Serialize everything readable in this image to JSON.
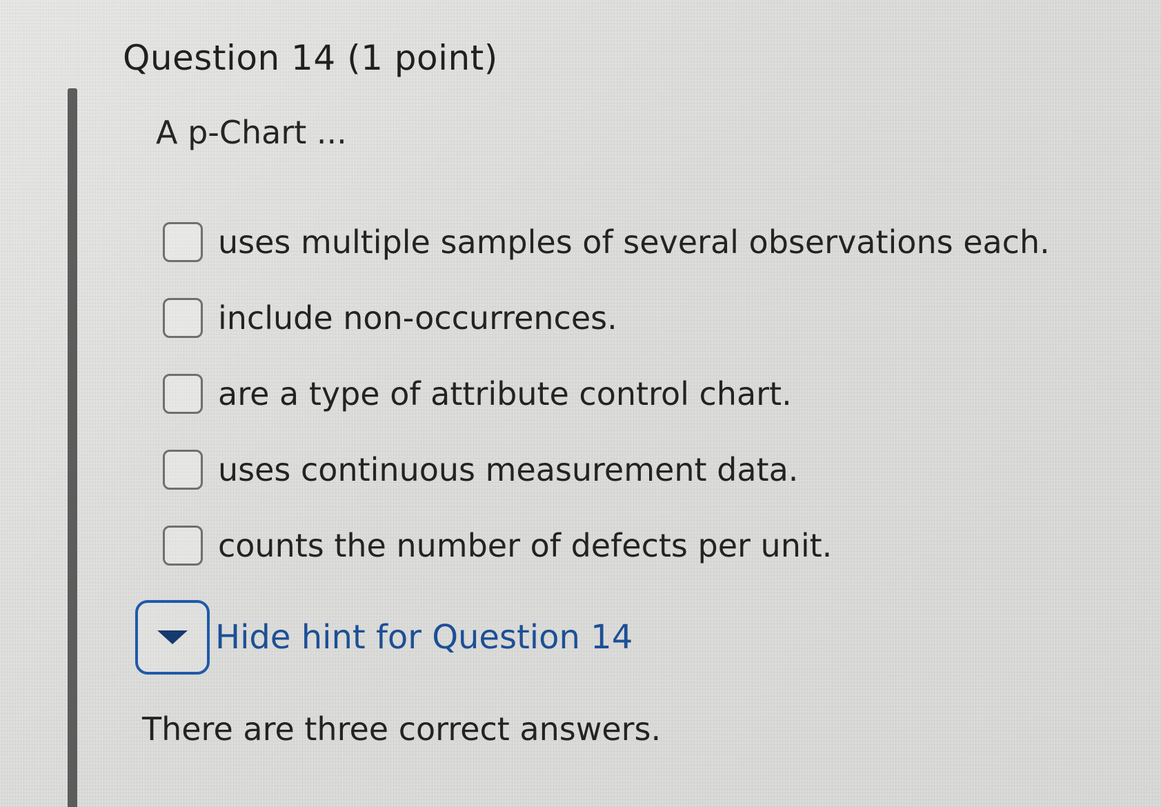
{
  "question": {
    "title": "Question 14",
    "points": "(1 point)",
    "prompt": "A p-Chart ...",
    "options": [
      {
        "label": "uses multiple samples of several observations each.",
        "checked": false
      },
      {
        "label": "include non-occurrences.",
        "checked": false
      },
      {
        "label": "are a type of attribute control chart.",
        "checked": false
      },
      {
        "label": "uses continuous measurement data.",
        "checked": false
      },
      {
        "label": "counts the number of defects per unit.",
        "checked": false
      }
    ]
  },
  "hint": {
    "toggle_label": "Hide hint for Question 14",
    "toggle_icon": "caret-down-icon",
    "text": "There are three correct answers.",
    "expanded": true
  },
  "colors": {
    "hint_link": "#1c4f96",
    "hint_border": "#1e5aa8",
    "left_rule": "#5c5c5c"
  }
}
